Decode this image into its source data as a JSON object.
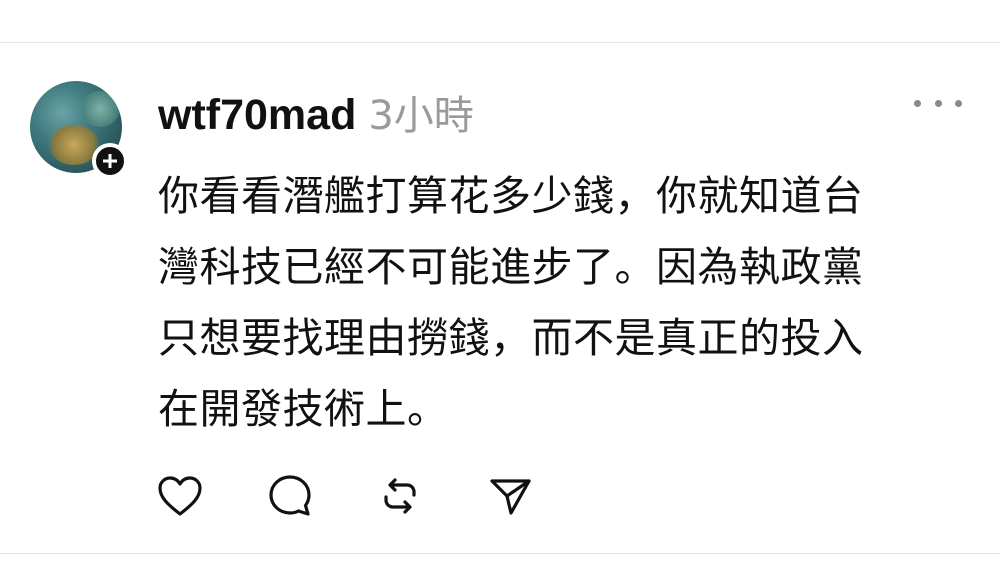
{
  "post": {
    "username": "wtf70mad",
    "timestamp": "3小時",
    "avatar_icon": "avatar-photo",
    "follow_icon": "plus-icon",
    "more_icon": "more-dots-icon",
    "body_lines": [
      "你看看潛艦打算花多少錢，你就知道台",
      "灣科技已經不可能進步了。因為執政黨",
      "只想要找理由撈錢，而不是真正的投入",
      "在開發技術上。"
    ],
    "actions": {
      "like_icon": "heart-icon",
      "reply_icon": "comment-icon",
      "repost_icon": "repost-icon",
      "share_icon": "send-icon"
    }
  },
  "colors": {
    "text": "#111111",
    "muted": "#9a9a9a",
    "divider": "#e4e4e4"
  }
}
